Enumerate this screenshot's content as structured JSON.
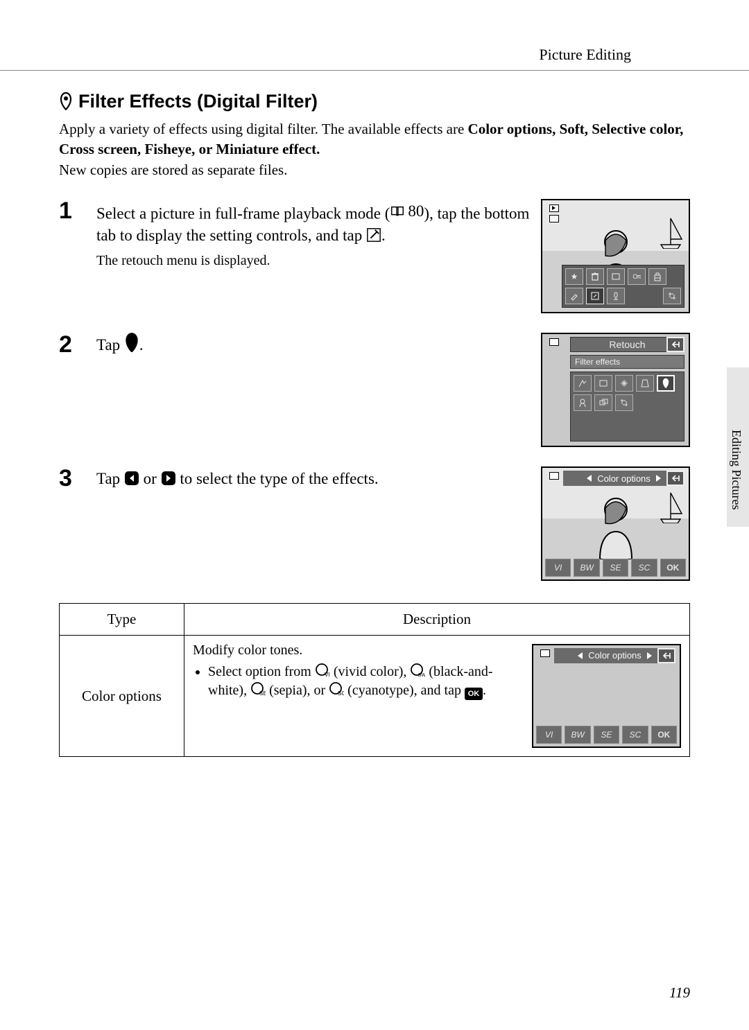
{
  "running_head": "Picture Editing",
  "section_title": "Filter Effects (Digital Filter)",
  "intro": {
    "sentence_a": "Apply a variety of effects using digital filter. The available effects are",
    "effects": "Color options, Soft, Selective color, Cross screen, Fisheye, or Miniature effect.",
    "sentence_b": "New copies are stored as separate files."
  },
  "steps": [
    {
      "num": "1",
      "head_before_ref": "Select a picture in full-frame playback mode (",
      "page_ref": "80",
      "head_after_ref": "), tap the bottom tab to display the setting controls, and tap",
      "head_end": ".",
      "sub": "The retouch menu is displayed."
    },
    {
      "num": "2",
      "head_before": "Tap",
      "head_after": "."
    },
    {
      "num": "3",
      "head_before": "Tap",
      "head_mid": "or",
      "head_after": "to select the type of the effects."
    }
  ],
  "figure2": {
    "title": "Retouch",
    "subtitle": "Filter effects"
  },
  "figure3": {
    "title": "Color options",
    "ok": "OK",
    "variants": [
      "VI",
      "BW",
      "SE",
      "SC"
    ]
  },
  "table": {
    "headers": {
      "type": "Type",
      "desc": "Description"
    },
    "row1": {
      "type": "Color options",
      "lead": "Modify color tones.",
      "bullet_before": "Select option from",
      "opt_vivid": "(vivid color),",
      "opt_bw": "(black-and-white),",
      "opt_sepia": "(sepia), or",
      "opt_cyan": "(cyanotype), and tap",
      "bullet_end": "."
    },
    "row1_fig": {
      "title": "Color options",
      "variants": [
        "VI",
        "BW",
        "SE",
        "SC"
      ],
      "ok": "OK"
    }
  },
  "side_tab": "Editing Pictures",
  "page_number": "119"
}
